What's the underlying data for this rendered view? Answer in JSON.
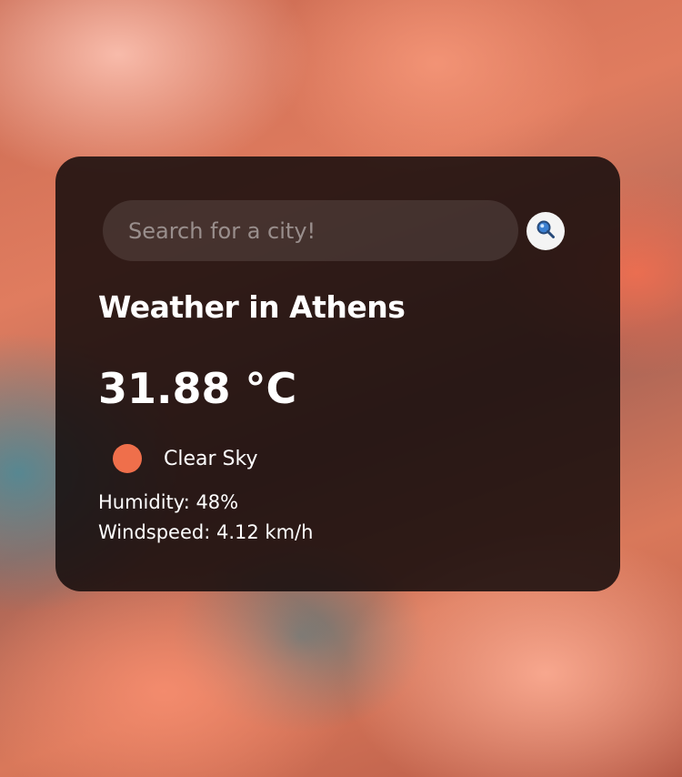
{
  "search": {
    "placeholder": "Search for a city!",
    "value": "",
    "button_icon": "search-icon"
  },
  "weather": {
    "title": "Weather in Athens",
    "temperature": "31.88 °C",
    "condition": "Clear Sky",
    "condition_icon": "sun-icon",
    "condition_color": "#ef6f4b",
    "humidity": "Humidity: 48%",
    "windspeed": "Windspeed: 4.12 km/h"
  },
  "colors": {
    "card_background": "#140c0c",
    "text": "#ffffff",
    "search_button": "#f4f4f4",
    "magnifier_lens": "#3b7fd1"
  }
}
